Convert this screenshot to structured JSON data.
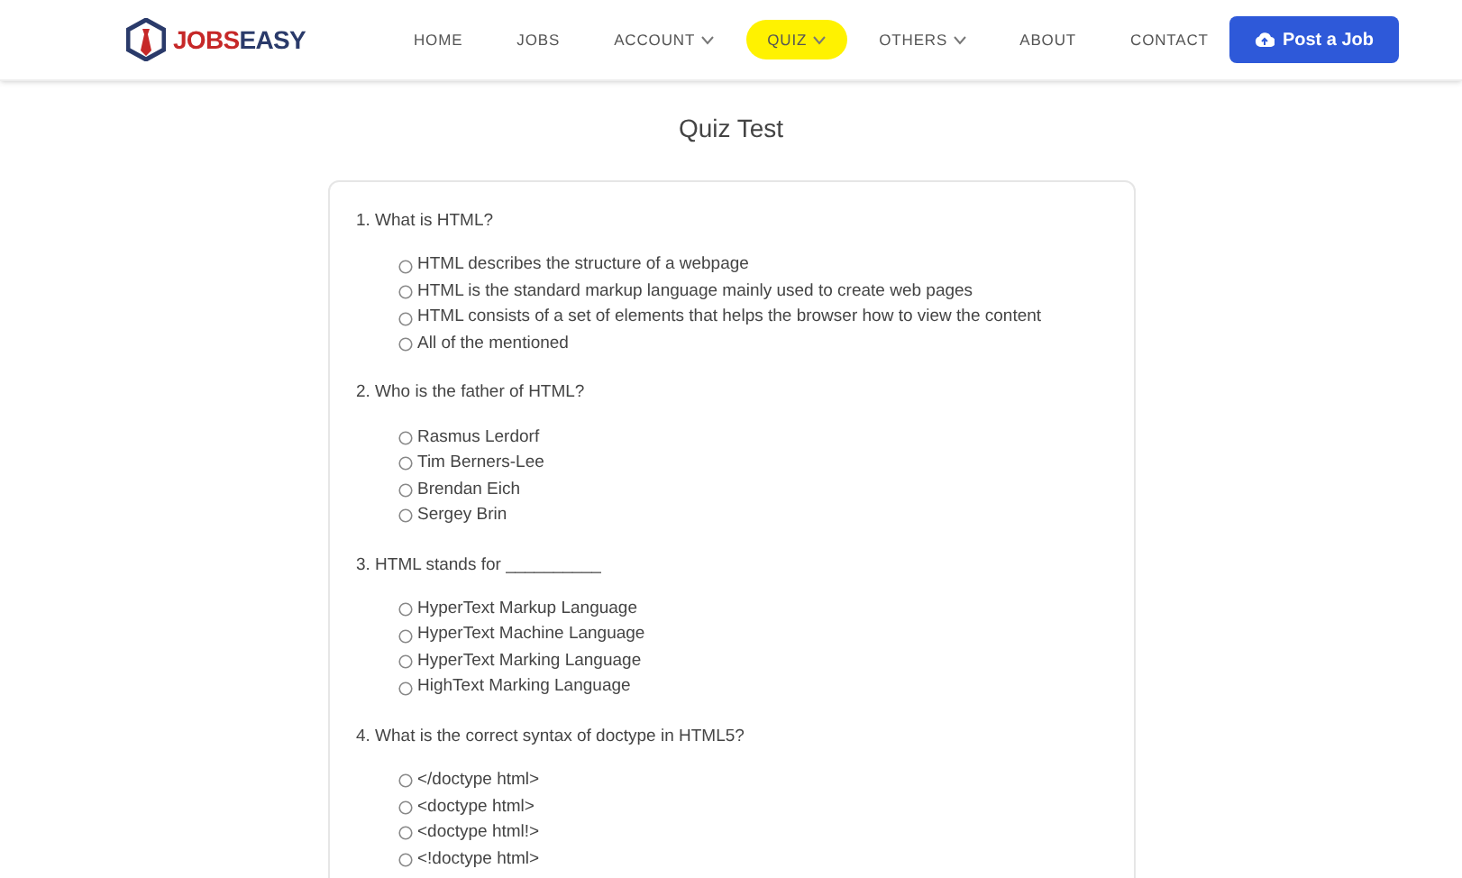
{
  "brand": {
    "name_part1": "JOBS",
    "name_part2": "EASY"
  },
  "nav": [
    {
      "label": "HOME",
      "dropdown": false,
      "selected": false
    },
    {
      "label": "JOBS",
      "dropdown": false,
      "selected": false
    },
    {
      "label": "ACCOUNT",
      "dropdown": true,
      "selected": false
    },
    {
      "label": "QUIZ",
      "dropdown": true,
      "selected": true
    },
    {
      "label": "OTHERS",
      "dropdown": true,
      "selected": false
    },
    {
      "label": "ABOUT",
      "dropdown": false,
      "selected": false
    },
    {
      "label": "CONTACT",
      "dropdown": false,
      "selected": false
    }
  ],
  "post_button": "Post a Job",
  "page_title": "Quiz Test",
  "questions": [
    {
      "text": "1. What is HTML?",
      "options": [
        {
          "label": "HTML describes the structure of a webpage",
          "selected": false
        },
        {
          "label": "HTML is the standard markup language mainly used to create web pages",
          "selected": false
        },
        {
          "label": "HTML consists of a set of elements that helps the browser how to view the content",
          "selected": false
        },
        {
          "label": "All of the mentioned",
          "selected": false
        }
      ]
    },
    {
      "text": "2. Who is the father of HTML?",
      "options": [
        {
          "label": "Rasmus Lerdorf",
          "selected": false
        },
        {
          "label": "Tim Berners-Lee",
          "selected": false
        },
        {
          "label": "Brendan Eich",
          "selected": false
        },
        {
          "label": "Sergey Brin",
          "selected": false
        }
      ]
    },
    {
      "text": "3. HTML stands for __________",
      "options": [
        {
          "label": "HyperText Markup Language",
          "selected": false
        },
        {
          "label": "HyperText Machine Language",
          "selected": false
        },
        {
          "label": "HyperText Marking Language",
          "selected": false
        },
        {
          "label": "HighText Marking Language",
          "selected": false
        }
      ]
    },
    {
      "text": "4. What is the correct syntax of doctype in HTML5?",
      "options": [
        {
          "label": "</doctype html>",
          "selected": false
        },
        {
          "label": "<doctype html>",
          "selected": false
        },
        {
          "label": "<doctype html!>",
          "selected": false
        },
        {
          "label": "<!doctype html>",
          "selected": false
        }
      ]
    }
  ]
}
